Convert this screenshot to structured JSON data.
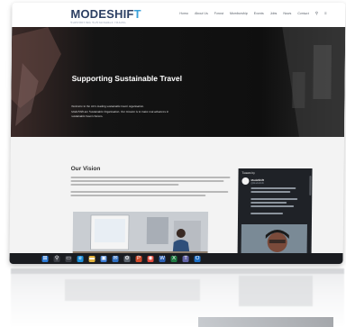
{
  "site": {
    "logo_primary": "MODESHIF",
    "logo_accent": "T",
    "logo_tagline": "SUPPORTING SUSTAINABLE TRAVEL",
    "nav_items": [
      "Home",
      "About Us",
      "Forest",
      "Membership",
      "Events",
      "Jobs",
      "News",
      "Contact"
    ],
    "search_icon": "search-icon",
    "menu_icon": "menu-icon"
  },
  "hero": {
    "title": "Supporting Sustainable Travel",
    "line1": "Welcome to the UK's leading sustainable travel organisation.",
    "line2": "ModeShift are Sustainable Organisation. Our mission is to make real advances in",
    "line3": "sustainable travel choices."
  },
  "vision": {
    "title": "Our Vision"
  },
  "twitter_widget": {
    "header": "Tweets by",
    "name": "ModeShift",
    "handle": "@ModeShift"
  },
  "taskbar": {
    "icons": [
      {
        "name": "start-icon",
        "color": "#2b79d6",
        "glyph": "⊞"
      },
      {
        "name": "search-icon",
        "color": "#3a3d44",
        "glyph": "⚲"
      },
      {
        "name": "task-view-icon",
        "color": "#3a3d44",
        "glyph": "▭"
      },
      {
        "name": "edge-icon",
        "color": "#1c8fd8",
        "glyph": "e"
      },
      {
        "name": "file-explorer-icon",
        "color": "#e0b03a",
        "glyph": "▬"
      },
      {
        "name": "store-icon",
        "color": "#3a7bd5",
        "glyph": "▣"
      },
      {
        "name": "mail-icon",
        "color": "#2f6fc2",
        "glyph": "✉"
      },
      {
        "name": "settings-icon",
        "color": "#5e6670",
        "glyph": "⚙"
      },
      {
        "name": "powerpoint-icon",
        "color": "#d04a2a",
        "glyph": "P"
      },
      {
        "name": "chrome-icon",
        "color": "#e0483a",
        "glyph": "◉"
      },
      {
        "name": "word-icon",
        "color": "#2b5fb3",
        "glyph": "W"
      },
      {
        "name": "excel-icon",
        "color": "#1f7a43",
        "glyph": "X"
      },
      {
        "name": "teams-icon",
        "color": "#6264a7",
        "glyph": "T"
      },
      {
        "name": "outlook-icon",
        "color": "#1c6fc7",
        "glyph": "O"
      }
    ]
  }
}
